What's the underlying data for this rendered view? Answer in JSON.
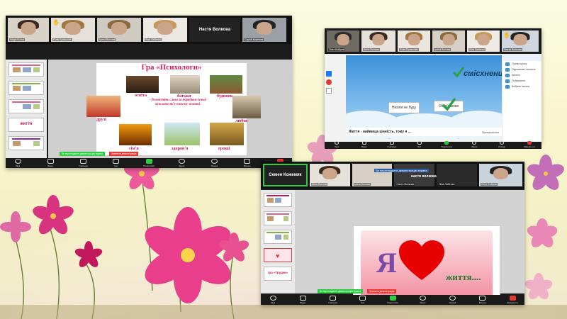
{
  "colors": {
    "accent_green": "#2ecc40",
    "slide_pink": "#d81b60",
    "zoom_dark": "#1a1a1a"
  },
  "window1": {
    "participants": [
      {
        "name": "Надія Колос",
        "active": true
      },
      {
        "name": "Юлія Брижкова"
      },
      {
        "name": "Ірина Волова"
      },
      {
        "name": "Ліна Лабенко"
      },
      {
        "name": "Настя Волкова",
        "name_only": true
      },
      {
        "name": "Сергій Кожемяк"
      }
    ],
    "slide": {
      "title": "Гра «Психологи»",
      "words": [
        "освіта",
        "батьки",
        "будинок",
        "друзі",
        "любов",
        "сім'я",
        "здоров'я",
        "гроші"
      ],
      "instruction": "- Розмістіть слова за порядком їхньої важливості у твоєму житті."
    },
    "thumbnails": [
      {
        "label": ""
      },
      {
        "label": ""
      },
      {
        "label": ""
      },
      {
        "label": "життя"
      },
      {
        "label": ""
      }
    ],
    "toolbar": [
      "Звук",
      "Відео",
      "Учасники",
      "Чат",
      "Поділитися",
      "Запис",
      "Реакції",
      "Більше",
      "Завершити"
    ],
    "status_pills": [
      "Ви переглядаєте демонстрацію екрана",
      "Зупинити демонстрацію"
    ]
  },
  "window2": {
    "participants": [
      {
        "name": "Олег Бобров"
      },
      {
        "name": "Анна Волова"
      },
      {
        "name": "Юлія Брижкова"
      },
      {
        "name": "Ірина Волова"
      },
      {
        "name": "Ліна Лабенко"
      },
      {
        "name": "Настя Волкова"
      }
    ],
    "slide": {
      "title": "смісхненим",
      "btn_left": "Ніколи не буду",
      "btn_right": "Обов'язково"
    },
    "panel_items": [
      "Оцінка уроку",
      "Підсумкове питання",
      "Анкета",
      "Побажання",
      "Вибірка питань"
    ],
    "caption": "Життя - найвища цінність, тому я ...",
    "caption_right": "Приєднатися",
    "toolbar": [
      "Звук",
      "Відео",
      "Учасники",
      "Чат",
      "Поділитися",
      "Запис",
      "Реакції",
      "Завершити"
    ]
  },
  "window3": {
    "participants": [
      {
        "name": "Семен Кожемяк",
        "name_only": true,
        "active": true
      },
      {
        "name": "Анна Волова"
      },
      {
        "name": "Ірина Волова"
      },
      {
        "name": "Настя Волкова"
      },
      {
        "name": "Ліна Лабенко"
      },
      {
        "name": "Олег Бобров"
      }
    ],
    "top_info_left": "Ви переглядаєте демонстрацію екрана",
    "top_info_mid": "настя волкова",
    "slide": {
      "ya": "Я",
      "zhyttia": "життя...."
    },
    "thumbnails": [
      {
        "label": ""
      },
      {
        "label": ""
      },
      {
        "label": ""
      },
      {
        "label": ""
      },
      {
        "label": "гра «Грудки»"
      }
    ],
    "toolbar": [
      "Звук",
      "Відео",
      "Учасники",
      "Чат",
      "Поділитися",
      "Запис",
      "Реакції",
      "Більше",
      "Завершити"
    ],
    "status_pills": [
      "Ви переглядаєте демонстрацію екрана",
      "Зупинити демонстрацію"
    ]
  }
}
